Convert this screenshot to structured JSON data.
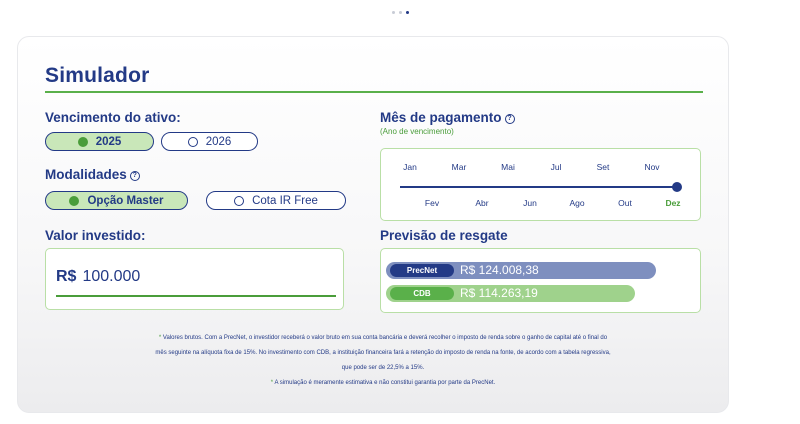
{
  "pagination": {
    "total": 3,
    "active": 2
  },
  "simulator": {
    "title": "Simulador",
    "vencimento": {
      "label": "Vencimento do ativo:",
      "options": [
        {
          "label": "2025",
          "selected": true
        },
        {
          "label": "2026",
          "selected": false
        }
      ]
    },
    "modalidades": {
      "label": "Modalidades",
      "help_icon": "?",
      "options": [
        {
          "label": "Opção Master",
          "selected": true
        },
        {
          "label": "Cota IR Free",
          "selected": false
        }
      ]
    },
    "valor": {
      "label": "Valor investido:",
      "currency": "R$",
      "amount": "100.000"
    },
    "mes_pagamento": {
      "label": "Mês de pagamento",
      "help_icon": "?",
      "subtitle": "(Ano de vencimento)",
      "months_top": [
        "Jan",
        "Mar",
        "Mai",
        "Jul",
        "Set",
        "Nov"
      ],
      "months_bottom": [
        "Fev",
        "Abr",
        "Jun",
        "Ago",
        "Out",
        "Dez"
      ],
      "selected": "Dez"
    },
    "previsao": {
      "label": "Previsão de resgate",
      "bars": [
        {
          "tag": "PrecNet",
          "value": "R$ 124.008,38",
          "color": "#7e8fbf",
          "tag_color": "#233a86",
          "fill": 1.0
        },
        {
          "tag": "CDB",
          "value": "R$ 114.263,19",
          "color": "#9fd28c",
          "tag_color": "#5ab04a",
          "fill": 0.921
        }
      ]
    },
    "footnotes": [
      "Valores brutos. Com a PrecNet, o investidor receberá o valor bruto em sua conta bancária e deverá recolher o imposto de renda sobre o ganho de capital até o final do",
      "mês seguinte na alíquota fixa de 15%. No investimento com CDB, a instituição financeira fará a retenção do imposto de renda na fonte, de acordo com a tabela regressiva,",
      "que pode ser de 22,5% a 15%.",
      "A simulação é meramente estimativa e não constitui garantia por parte da PrecNet."
    ],
    "footnote_marker": "*"
  }
}
